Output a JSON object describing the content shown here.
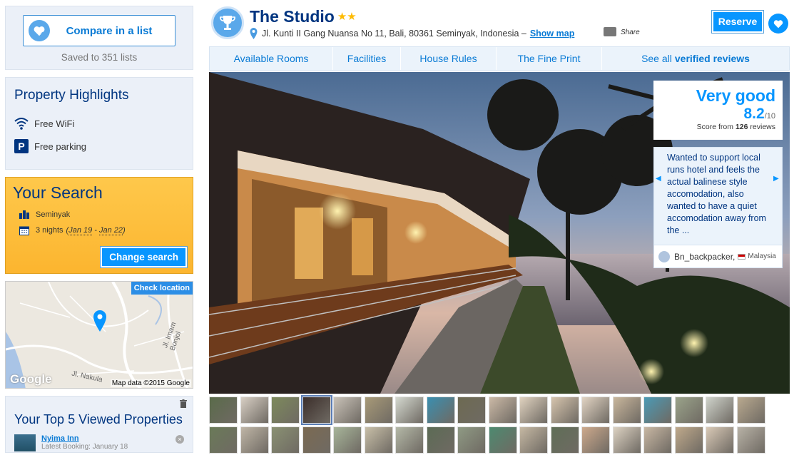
{
  "compare": {
    "button_label": "Compare in a list",
    "saved_text": "Saved to 351 lists"
  },
  "highlights": {
    "title": "Property Highlights",
    "items": [
      {
        "icon": "wifi-icon",
        "label": "Free WiFi"
      },
      {
        "icon": "parking-icon",
        "label": "Free parking"
      }
    ]
  },
  "search": {
    "title": "Your Search",
    "destination": "Seminyak",
    "nights": "3 nights",
    "date_open": "(",
    "checkin": "Jan 19",
    "date_sep": " - ",
    "checkout": "Jan 22",
    "date_close": ")",
    "change_label": "Change search"
  },
  "map": {
    "check_label": "Check location",
    "attribution": "Map data ©2015 Google",
    "logo": "Google",
    "street_1": "Jl. Imam Bonjol",
    "street_2": "Jl. Nakula"
  },
  "top5": {
    "title": "Your Top 5 Viewed Properties",
    "items": [
      {
        "name": "Nyima Inn",
        "sub": "Latest Booking: January 18"
      }
    ]
  },
  "hotel": {
    "name": "The Studio",
    "stars": "★★",
    "address": "Jl. Kunti II Gang Nuansa No 11, Bali, 80361 Seminyak, Indonesia –",
    "show_map": "Show map",
    "share": "Share",
    "reserve": "Reserve"
  },
  "tabs": [
    {
      "label": "Available Rooms"
    },
    {
      "label": "Facilities"
    },
    {
      "label": "House Rules"
    },
    {
      "label": "The Fine Print"
    },
    {
      "label": "See all",
      "bold": "verified reviews"
    }
  ],
  "score": {
    "label": "Very good",
    "value": "8.2",
    "out_of": "/10",
    "from_prefix": "Score from",
    "count": "126",
    "from_suffix": "reviews"
  },
  "review": {
    "text": "Wanted to support local runs hotel and feels the actual balinese style accomodation, also wanted to have a quiet accomodation away from the ...",
    "author": "Bn_backpacker,",
    "country": "Malaysia"
  },
  "colors": {
    "brand_blue": "#003580",
    "action_blue": "#0896ff",
    "link_blue": "#0a7bd5",
    "search_yellow": "#febb02"
  }
}
